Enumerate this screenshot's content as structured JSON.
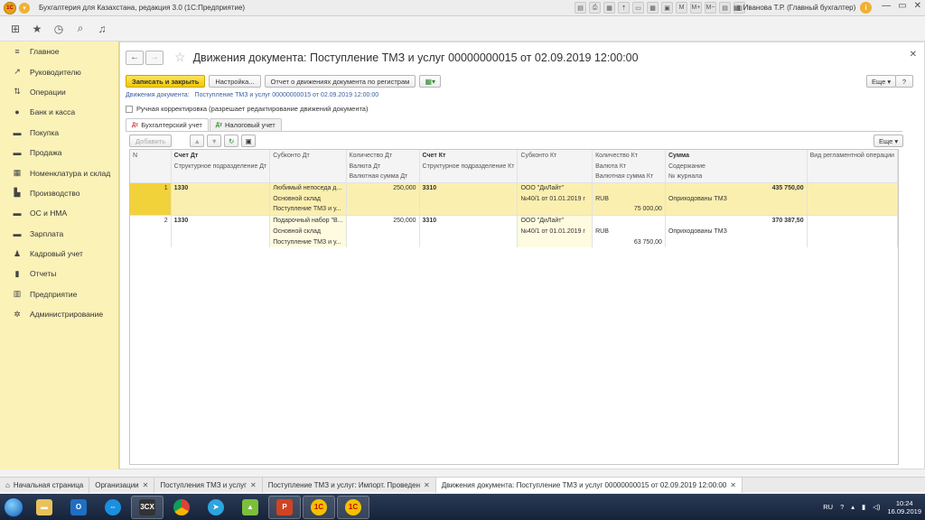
{
  "window": {
    "title": "Бухгалтерия для Казахстана, редакция 3.0  (1С:Предприятие)",
    "user": "Иванова Т.Р. (Главный бухгалтер)"
  },
  "sidebar": {
    "items": [
      {
        "label": "Главное",
        "icon": "menu-icon"
      },
      {
        "label": "Руководителю",
        "icon": "chart-icon"
      },
      {
        "label": "Операции",
        "icon": "operations-icon"
      },
      {
        "label": "Банк и касса",
        "icon": "bank-icon"
      },
      {
        "label": "Покупка",
        "icon": "cart-icon"
      },
      {
        "label": "Продажа",
        "icon": "sales-icon"
      },
      {
        "label": "Номенклатура и склад",
        "icon": "warehouse-icon"
      },
      {
        "label": "Производство",
        "icon": "factory-icon"
      },
      {
        "label": "ОС и НМА",
        "icon": "assets-icon"
      },
      {
        "label": "Зарплата",
        "icon": "salary-icon"
      },
      {
        "label": "Кадровый учет",
        "icon": "staff-icon"
      },
      {
        "label": "Отчеты",
        "icon": "reports-icon"
      },
      {
        "label": "Предприятие",
        "icon": "company-icon"
      },
      {
        "label": "Администрирование",
        "icon": "gear-icon"
      }
    ]
  },
  "document": {
    "title": "Движения документа: Поступление ТМЗ и услуг 00000000015 от 02.09.2019 12:00:00",
    "toolbar": {
      "save_close": "Записать и закрыть",
      "settings": "Настройка...",
      "report": "Отчет о движениях документа по регистрам",
      "more": "Еще",
      "help": "?"
    },
    "links": {
      "label": "Движения документа:",
      "doc": "Поступление ТМЗ и услуг 00000000015 от 02.09.2019 12:00:00"
    },
    "manual_checkbox": "Ручная корректировка (разрешает редактирование движений документа)",
    "tabs": [
      {
        "label": "Бухгалтерский учет"
      },
      {
        "label": "Налоговый учет"
      }
    ],
    "subbar": {
      "add": "Добавить",
      "more": "Еще"
    }
  },
  "table": {
    "headers": {
      "n": "N",
      "acc_dt": "Счет Дт",
      "sub_dt": "Субконто Дт",
      "qty_dt": "Количество Дт",
      "acc_kt": "Счет Кт",
      "sub_kt": "Субконто Кт",
      "qty_kt": "Количество Кт",
      "sum": "Сумма",
      "reg_type": "Вид регламентной операции",
      "struct_dt": "Структурное подразделение Дт",
      "cur_dt": "Валюта Дт",
      "cur_sum_dt": "Валютная сумма Дт",
      "struct_kt": "Структурное подразделение Кт",
      "cur_kt": "Валюта Кт",
      "cur_sum_kt": "Валютная сумма Кт",
      "content": "Содержание",
      "journal": "№ журнала"
    },
    "rows": [
      {
        "n": "1",
        "acc_dt": "1330",
        "sub_dt": [
          "Любимый непоседа д...",
          "Основной склад",
          "Поступление ТМЗ и у..."
        ],
        "qty_dt": "250,000",
        "acc_kt": "3310",
        "sub_kt": [
          "ООО \"ДиЛайт\"",
          "№40/1 от 01.01.2019 г",
          ""
        ],
        "cur_kt": "RUB",
        "cur_sum_kt": "75 000,00",
        "sum": "435 750,00",
        "content": "Оприходованы ТМЗ"
      },
      {
        "n": "2",
        "acc_dt": "1330",
        "sub_dt": [
          "Подарочный набор \"В...",
          "Основной склад",
          "Поступление ТМЗ и у..."
        ],
        "qty_dt": "250,000",
        "acc_kt": "3310",
        "sub_kt": [
          "ООО \"ДиЛайт\"",
          "№40/1 от 01.01.2019 г",
          ""
        ],
        "cur_kt": "RUB",
        "cur_sum_kt": "63 750,00",
        "sum": "370 387,50",
        "content": "Оприходованы ТМЗ"
      }
    ]
  },
  "bottom_tabs": [
    {
      "label": "Начальная страница",
      "active": false
    },
    {
      "label": "Организации",
      "active": false
    },
    {
      "label": "Поступления ТМЗ и услуг",
      "active": false
    },
    {
      "label": "Поступление ТМЗ и услуг: Импорт. Проведен",
      "active": false
    },
    {
      "label": "Движения документа: Поступление ТМЗ и услуг 00000000015 от 02.09.2019 12:00:00",
      "active": true
    }
  ],
  "taskbar": {
    "lang": "RU",
    "time": "10:24",
    "date": "16.09.2019",
    "apps": [
      "explorer",
      "outlook",
      "teamviewer",
      "3cx",
      "chrome",
      "telegram",
      "android",
      "powerpoint",
      "1c",
      "1c-2"
    ]
  }
}
